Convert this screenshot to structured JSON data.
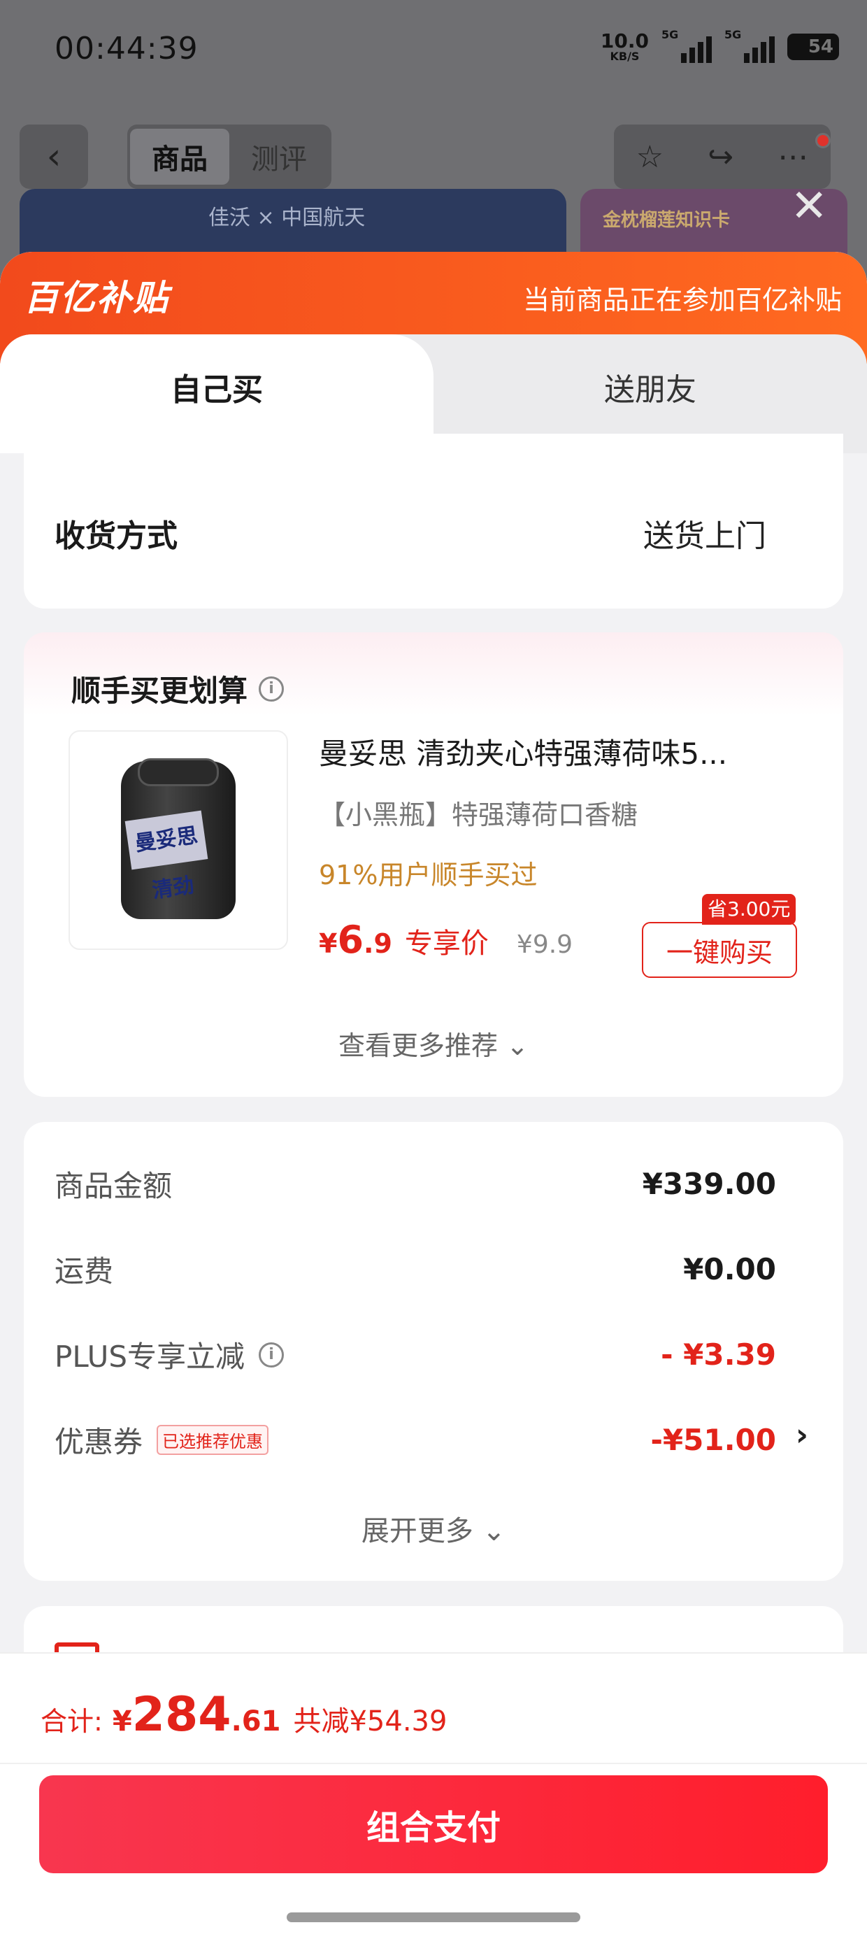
{
  "status_bar": {
    "time": "00:44:39",
    "net_speed": "10.0",
    "net_unit": "KB/S",
    "signal1": "5G",
    "signal2": "5G",
    "battery": "54"
  },
  "top_nav": {
    "tabs": [
      "商品",
      "测评"
    ],
    "active_tab": 0
  },
  "background_banners": {
    "left_text": "佳沃 × 中国航天",
    "right_text": "金枕榴莲知识卡"
  },
  "sheet": {
    "brand": "百亿补贴",
    "brand_note": "当前商品正在参加百亿补贴",
    "tabs": {
      "self": "自己买",
      "gift": "送朋友"
    },
    "delivery": {
      "label": "收货方式",
      "value": "送货上门"
    },
    "addon": {
      "title": "顺手买更划算",
      "product": {
        "name": "曼妥思 清劲夹心特强薄荷味5...",
        "desc": "【小黑瓶】特强薄荷口香糖",
        "social": "91%用户顺手买过",
        "price_yen": "¥",
        "price_int": "6",
        "price_dec": ".9",
        "price_tag": "专享价",
        "price_orig": "¥9.9",
        "save_badge": "省3.00元",
        "buy_label": "一键购买",
        "image_label": "曼妥思 清劲"
      },
      "more": "查看更多推荐 ⌄"
    },
    "summary": {
      "rows": [
        {
          "label": "商品金额",
          "value": "¥339.00"
        },
        {
          "label": "运费",
          "value": "¥0.00"
        },
        {
          "label": "PLUS专享立减",
          "value": "- ¥3.39"
        },
        {
          "label": "优惠券",
          "tag": "已选推荐优惠",
          "value": "-¥51.00"
        }
      ],
      "expand": "展开更多 ⌄"
    }
  },
  "footer": {
    "total_label": "合计:",
    "total_yen": "¥",
    "total_int": "284",
    "total_dec": ".61",
    "total_save": "共减¥54.39",
    "pay_label": "组合支付"
  },
  "colors": {
    "brand_orange": "#f24a1c",
    "price_red": "#e2231a",
    "pay_button": "#ff1e2c",
    "social_gold": "#c8862a"
  }
}
